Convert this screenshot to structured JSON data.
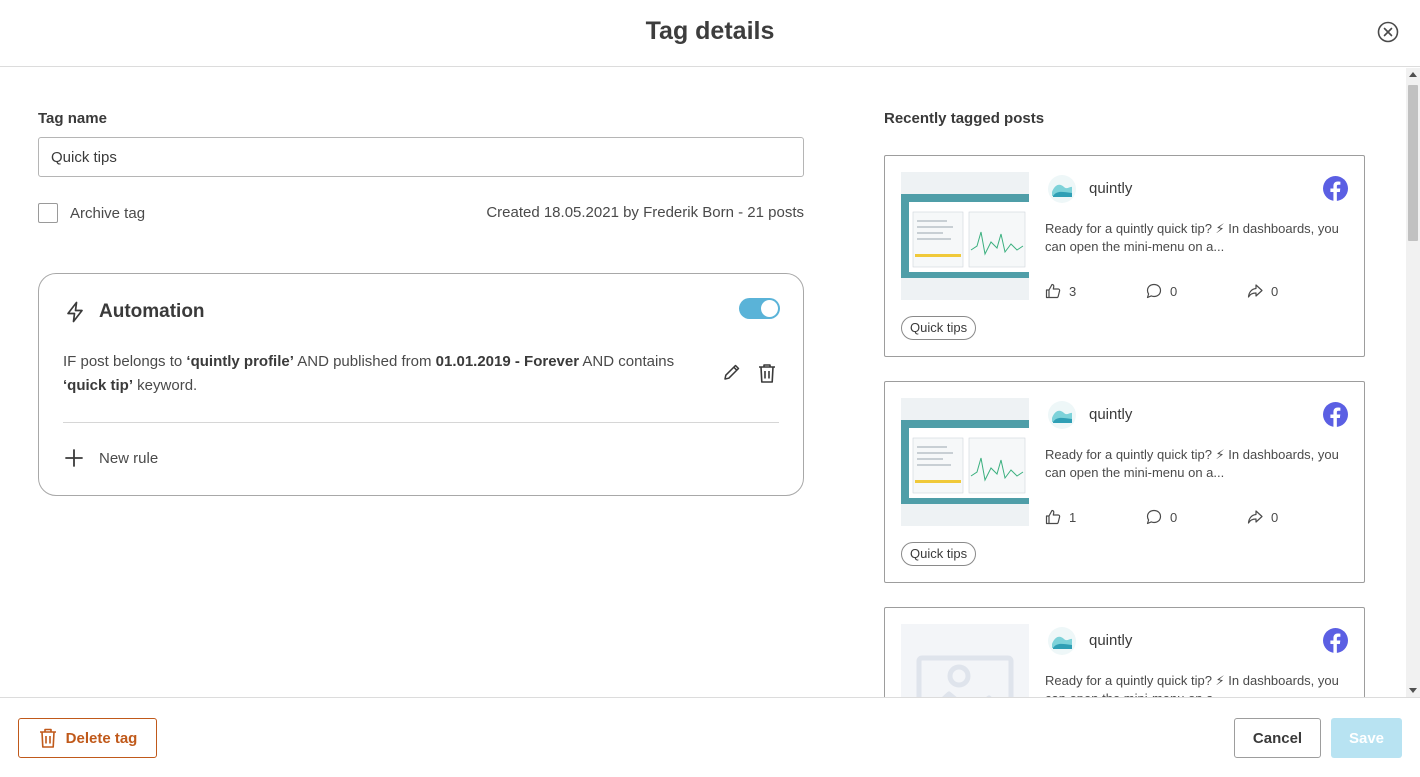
{
  "dialog": {
    "title": "Tag details"
  },
  "form": {
    "tag_name_label": "Tag name",
    "tag_name_value": "Quick tips",
    "archive_label": "Archive tag",
    "archive_checked": false,
    "created_info": "Created 18.05.2021 by Frederik Born  - 21 posts"
  },
  "automation": {
    "title": "Automation",
    "enabled": true,
    "rule": {
      "t1": "IF post belongs to ",
      "b1": "‘quintly profile’",
      "t2": " AND published from ",
      "b2": "01.01.2019 - Forever",
      "t3": " AND contains ",
      "b3": "‘quick tip’",
      "t4": " keyword."
    },
    "new_rule_label": "New rule"
  },
  "recent_posts": {
    "title": "Recently tagged posts",
    "posts": [
      {
        "profile": "quintly",
        "network": "facebook-icon",
        "text": "Ready for a quintly quick tip? ⚡ In dashboards, you can open the mini-menu on a...",
        "likes": "3",
        "comments": "0",
        "shares": "0",
        "tag": "Quick tips",
        "thumbnail": "dashboard-screenshot"
      },
      {
        "profile": "quintly",
        "network": "facebook-icon",
        "text": "Ready for a quintly quick tip? ⚡ In dashboards, you can open the mini-menu on a...",
        "likes": "1",
        "comments": "0",
        "shares": "0",
        "tag": "Quick tips",
        "thumbnail": "dashboard-screenshot"
      },
      {
        "profile": "quintly",
        "network": "facebook-icon",
        "text": "Ready for a quintly quick tip? ⚡ In dashboards, you can open the mini-menu on a...",
        "likes": "",
        "comments": "",
        "shares": "",
        "tag": "",
        "thumbnail": "image-placeholder"
      }
    ]
  },
  "footer": {
    "delete_label": "Delete tag",
    "cancel_label": "Cancel",
    "save_label": "Save"
  },
  "colors": {
    "accent": "#5ab3d8",
    "danger": "#c0591a",
    "save_disabled": "#b8e3f2",
    "facebook": "#5b5fe3"
  }
}
